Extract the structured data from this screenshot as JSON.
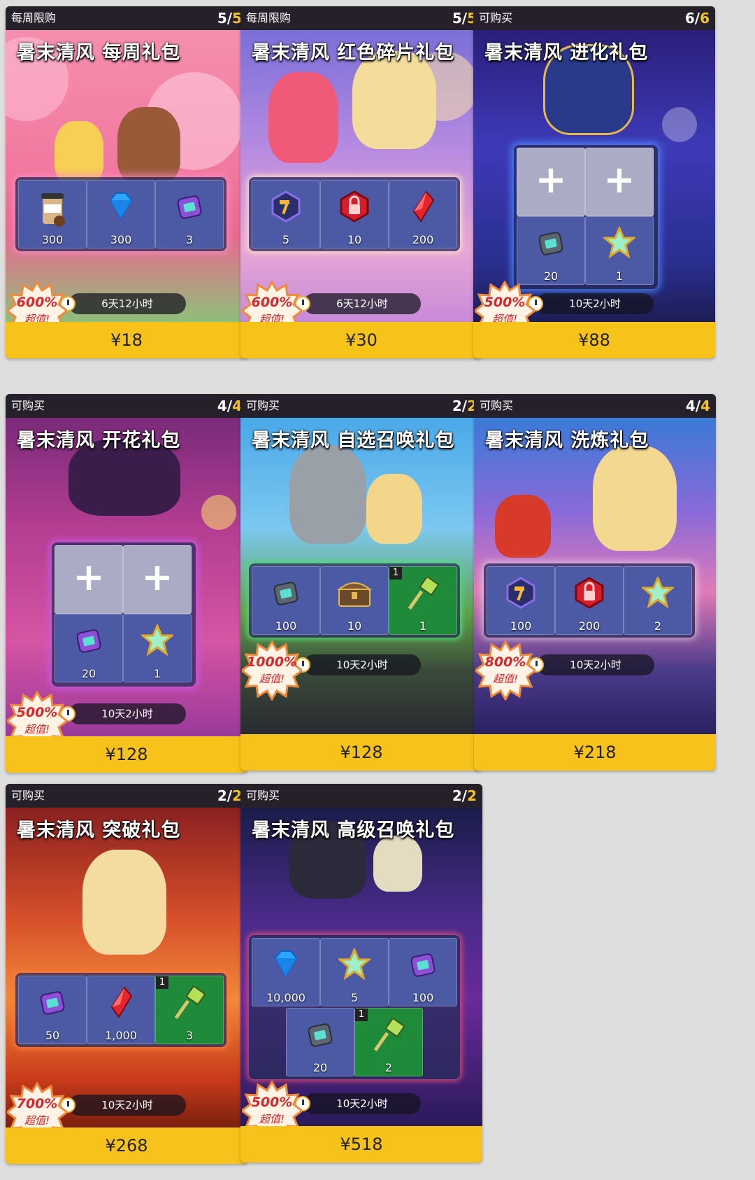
{
  "colors": {
    "price_bar": "#f7c21a",
    "count_max": "#f5c32a",
    "slot": "#4c5aa6",
    "slot_special": "#1f8a3a",
    "discount_text": "#d8262a"
  },
  "cards": [
    {
      "tag": "每周限购",
      "count": "5",
      "max": "5",
      "title": "暑末清风  每周礼包",
      "discount": "600%",
      "discount_sub": "超值!",
      "timer": "6天12小时",
      "price": "¥18",
      "items": [
        {
          "icon": "coffee-icon",
          "qty": "300"
        },
        {
          "icon": "diamond-icon",
          "qty": "300"
        },
        {
          "icon": "purple-device-icon",
          "qty": "3"
        }
      ]
    },
    {
      "tag": "每周限购",
      "count": "5",
      "max": "5",
      "title": "暑末清风  红色碎片礼包",
      "discount": "600%",
      "discount_sub": "超值!",
      "timer": "6天12小时",
      "price": "¥30",
      "items": [
        {
          "icon": "hammer-shard-icon",
          "qty": "5"
        },
        {
          "icon": "red-lock-icon",
          "qty": "10"
        },
        {
          "icon": "red-shard-icon",
          "qty": "200"
        }
      ]
    },
    {
      "tag": "可购买",
      "count": "6",
      "max": "6",
      "title": "暑末清风  进化礼包",
      "discount": "500%",
      "discount_sub": "超值!",
      "timer": "10天2小时",
      "price": "¥88",
      "items": [
        {
          "icon": "grey-device-icon",
          "qty": "20"
        },
        {
          "icon": "rainbow-star-icon",
          "qty": "1"
        }
      ]
    },
    {
      "tag": "可购买",
      "count": "4",
      "max": "4",
      "title": "暑末清风  开花礼包",
      "discount": "500%",
      "discount_sub": "超值!",
      "timer": "10天2小时",
      "price": "¥128",
      "items": [
        {
          "icon": "purple-device-icon",
          "qty": "20"
        },
        {
          "icon": "rainbow-star-icon",
          "qty": "1"
        }
      ]
    },
    {
      "tag": "可购买",
      "count": "2",
      "max": "2",
      "title": "暑末清风  自选召唤礼包",
      "discount": "1000%",
      "discount_sub": "超值!",
      "timer": "10天2小时",
      "price": "¥128",
      "items": [
        {
          "icon": "grey-device-icon",
          "qty": "100"
        },
        {
          "icon": "treasure-chest-icon",
          "qty": "10"
        },
        {
          "icon": "green-hammer-icon",
          "qty": "1",
          "badge": "1"
        }
      ]
    },
    {
      "tag": "可购买",
      "count": "4",
      "max": "4",
      "title": "暑末清风  洗炼礼包",
      "discount": "800%",
      "discount_sub": "超值!",
      "timer": "10天2小时",
      "price": "¥218",
      "items": [
        {
          "icon": "hammer-shard-icon",
          "qty": "100"
        },
        {
          "icon": "red-lock-icon",
          "qty": "200"
        },
        {
          "icon": "rainbow-star-icon",
          "qty": "2"
        }
      ]
    },
    {
      "tag": "可购买",
      "count": "2",
      "max": "2",
      "title": "暑末清风  突破礼包",
      "discount": "700%",
      "discount_sub": "超值!",
      "timer": "10天2小时",
      "price": "¥268",
      "items": [
        {
          "icon": "purple-device-icon",
          "qty": "50"
        },
        {
          "icon": "red-shard-icon",
          "qty": "1,000"
        },
        {
          "icon": "green-hammer-icon",
          "qty": "3",
          "badge": "1"
        }
      ]
    },
    {
      "tag": "可购买",
      "count": "2",
      "max": "2",
      "title": "暑末清风  高级召唤礼包",
      "discount": "500%",
      "discount_sub": "超值!",
      "timer": "10天2小时",
      "price": "¥518",
      "items": [
        {
          "icon": "diamond-icon",
          "qty": "10,000"
        },
        {
          "icon": "rainbow-star-icon",
          "qty": "5"
        },
        {
          "icon": "purple-device-icon",
          "qty": "100"
        },
        {
          "icon": "grey-device-icon",
          "qty": "20"
        },
        {
          "icon": "green-hammer-icon",
          "qty": "2",
          "badge": "1"
        }
      ]
    }
  ]
}
